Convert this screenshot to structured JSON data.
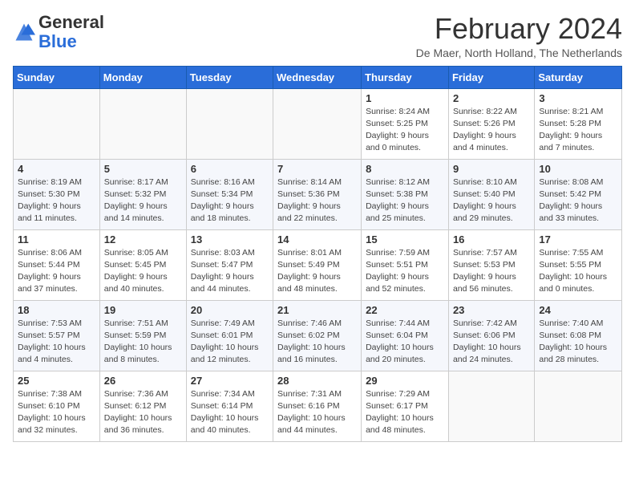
{
  "logo": {
    "general": "General",
    "blue": "Blue"
  },
  "calendar": {
    "title": "February 2024",
    "subtitle": "De Maer, North Holland, The Netherlands",
    "days_of_week": [
      "Sunday",
      "Monday",
      "Tuesday",
      "Wednesday",
      "Thursday",
      "Friday",
      "Saturday"
    ],
    "weeks": [
      [
        {
          "day": "",
          "info": ""
        },
        {
          "day": "",
          "info": ""
        },
        {
          "day": "",
          "info": ""
        },
        {
          "day": "",
          "info": ""
        },
        {
          "day": "1",
          "info": "Sunrise: 8:24 AM\nSunset: 5:25 PM\nDaylight: 9 hours\nand 0 minutes."
        },
        {
          "day": "2",
          "info": "Sunrise: 8:22 AM\nSunset: 5:26 PM\nDaylight: 9 hours\nand 4 minutes."
        },
        {
          "day": "3",
          "info": "Sunrise: 8:21 AM\nSunset: 5:28 PM\nDaylight: 9 hours\nand 7 minutes."
        }
      ],
      [
        {
          "day": "4",
          "info": "Sunrise: 8:19 AM\nSunset: 5:30 PM\nDaylight: 9 hours\nand 11 minutes."
        },
        {
          "day": "5",
          "info": "Sunrise: 8:17 AM\nSunset: 5:32 PM\nDaylight: 9 hours\nand 14 minutes."
        },
        {
          "day": "6",
          "info": "Sunrise: 8:16 AM\nSunset: 5:34 PM\nDaylight: 9 hours\nand 18 minutes."
        },
        {
          "day": "7",
          "info": "Sunrise: 8:14 AM\nSunset: 5:36 PM\nDaylight: 9 hours\nand 22 minutes."
        },
        {
          "day": "8",
          "info": "Sunrise: 8:12 AM\nSunset: 5:38 PM\nDaylight: 9 hours\nand 25 minutes."
        },
        {
          "day": "9",
          "info": "Sunrise: 8:10 AM\nSunset: 5:40 PM\nDaylight: 9 hours\nand 29 minutes."
        },
        {
          "day": "10",
          "info": "Sunrise: 8:08 AM\nSunset: 5:42 PM\nDaylight: 9 hours\nand 33 minutes."
        }
      ],
      [
        {
          "day": "11",
          "info": "Sunrise: 8:06 AM\nSunset: 5:44 PM\nDaylight: 9 hours\nand 37 minutes."
        },
        {
          "day": "12",
          "info": "Sunrise: 8:05 AM\nSunset: 5:45 PM\nDaylight: 9 hours\nand 40 minutes."
        },
        {
          "day": "13",
          "info": "Sunrise: 8:03 AM\nSunset: 5:47 PM\nDaylight: 9 hours\nand 44 minutes."
        },
        {
          "day": "14",
          "info": "Sunrise: 8:01 AM\nSunset: 5:49 PM\nDaylight: 9 hours\nand 48 minutes."
        },
        {
          "day": "15",
          "info": "Sunrise: 7:59 AM\nSunset: 5:51 PM\nDaylight: 9 hours\nand 52 minutes."
        },
        {
          "day": "16",
          "info": "Sunrise: 7:57 AM\nSunset: 5:53 PM\nDaylight: 9 hours\nand 56 minutes."
        },
        {
          "day": "17",
          "info": "Sunrise: 7:55 AM\nSunset: 5:55 PM\nDaylight: 10 hours\nand 0 minutes."
        }
      ],
      [
        {
          "day": "18",
          "info": "Sunrise: 7:53 AM\nSunset: 5:57 PM\nDaylight: 10 hours\nand 4 minutes."
        },
        {
          "day": "19",
          "info": "Sunrise: 7:51 AM\nSunset: 5:59 PM\nDaylight: 10 hours\nand 8 minutes."
        },
        {
          "day": "20",
          "info": "Sunrise: 7:49 AM\nSunset: 6:01 PM\nDaylight: 10 hours\nand 12 minutes."
        },
        {
          "day": "21",
          "info": "Sunrise: 7:46 AM\nSunset: 6:02 PM\nDaylight: 10 hours\nand 16 minutes."
        },
        {
          "day": "22",
          "info": "Sunrise: 7:44 AM\nSunset: 6:04 PM\nDaylight: 10 hours\nand 20 minutes."
        },
        {
          "day": "23",
          "info": "Sunrise: 7:42 AM\nSunset: 6:06 PM\nDaylight: 10 hours\nand 24 minutes."
        },
        {
          "day": "24",
          "info": "Sunrise: 7:40 AM\nSunset: 6:08 PM\nDaylight: 10 hours\nand 28 minutes."
        }
      ],
      [
        {
          "day": "25",
          "info": "Sunrise: 7:38 AM\nSunset: 6:10 PM\nDaylight: 10 hours\nand 32 minutes."
        },
        {
          "day": "26",
          "info": "Sunrise: 7:36 AM\nSunset: 6:12 PM\nDaylight: 10 hours\nand 36 minutes."
        },
        {
          "day": "27",
          "info": "Sunrise: 7:34 AM\nSunset: 6:14 PM\nDaylight: 10 hours\nand 40 minutes."
        },
        {
          "day": "28",
          "info": "Sunrise: 7:31 AM\nSunset: 6:16 PM\nDaylight: 10 hours\nand 44 minutes."
        },
        {
          "day": "29",
          "info": "Sunrise: 7:29 AM\nSunset: 6:17 PM\nDaylight: 10 hours\nand 48 minutes."
        },
        {
          "day": "",
          "info": ""
        },
        {
          "day": "",
          "info": ""
        }
      ]
    ]
  }
}
